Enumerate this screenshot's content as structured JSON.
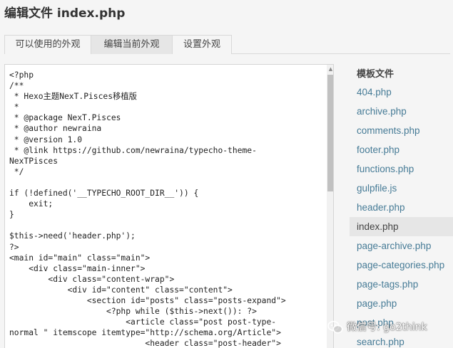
{
  "page": {
    "title": "编辑文件 index.php"
  },
  "tabs": [
    {
      "label": "可以使用的外观"
    },
    {
      "label": "编辑当前外观"
    },
    {
      "label": "设置外观"
    }
  ],
  "editor": {
    "lines": [
      "<?php",
      "/**",
      " * Hexo主题NexT.Pisces移植版",
      " *",
      " * @package NexT.Pisces",
      " * @author newraina",
      " * @version 1.0",
      " * @link https://github.com/newraina/typecho-theme-",
      "NexTPisces",
      " */",
      "",
      "if (!defined('__TYPECHO_ROOT_DIR__')) {",
      "    exit;",
      "}",
      "",
      "$this->need('header.php');",
      "?>",
      "<main id=\"main\" class=\"main\">",
      "    <div class=\"main-inner\">",
      "        <div class=\"content-wrap\">",
      "            <div id=\"content\" class=\"content\">",
      "                <section id=\"posts\" class=\"posts-expand\">",
      "                    <?php while ($this->next()): ?>",
      "                        <article class=\"post post-type-",
      "normal \" itemscope itemtype=\"http://schema.org/Article\">",
      "                            <header class=\"post-header\">"
    ]
  },
  "sidebar": {
    "heading": "模板文件",
    "files": [
      {
        "label": "404.php",
        "active": false
      },
      {
        "label": "archive.php",
        "active": false
      },
      {
        "label": "comments.php",
        "active": false
      },
      {
        "label": "footer.php",
        "active": false
      },
      {
        "label": "functions.php",
        "active": false
      },
      {
        "label": "gulpfile.js",
        "active": false
      },
      {
        "label": "header.php",
        "active": false
      },
      {
        "label": "index.php",
        "active": true
      },
      {
        "label": "page-archive.php",
        "active": false
      },
      {
        "label": "page-categories.php",
        "active": false
      },
      {
        "label": "page-tags.php",
        "active": false
      },
      {
        "label": "page.php",
        "active": false
      },
      {
        "label": "post.php",
        "active": false
      },
      {
        "label": "search.php",
        "active": false
      }
    ]
  },
  "watermark": {
    "text": "微信号: go2think",
    "icon": "wechat-icon"
  },
  "colors": {
    "link": "#467b96",
    "active_bg": "#e6e6e6",
    "page_bg": "#f5f5f5"
  }
}
